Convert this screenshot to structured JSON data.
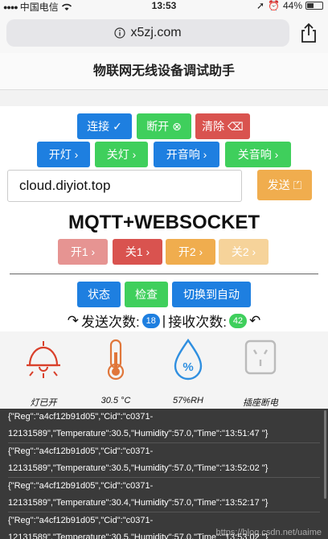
{
  "status": {
    "carrier": "中国电信",
    "time": "13:53",
    "battery": "44%",
    "battery_level": 0.44
  },
  "browser": {
    "url": "x5zj.com"
  },
  "page": {
    "title": "物联网无线设备调试助手"
  },
  "buttons": {
    "connect": "连接 ✓",
    "disconnect": "断开 ⊗",
    "clear": "清除 ⌫",
    "light_on": "开灯 ›",
    "light_off": "关灯 ›",
    "sound_on": "开音响 ›",
    "sound_off": "关音响 ›",
    "on1": "开1 ›",
    "off1": "关1 ›",
    "on2": "开2 ›",
    "off2": "关2 ›",
    "status": "状态",
    "check": "检查",
    "auto": "切换到自动"
  },
  "host": {
    "value": "cloud.diyiot.top"
  },
  "send_label": "发送 ⏍",
  "mqtt_title": "MQTT+WEBSOCKET",
  "counter": {
    "send_label": "发送次数:",
    "send_count": "18",
    "separator": "|",
    "recv_label": "接收次数:",
    "recv_count": "42"
  },
  "devices": [
    {
      "label": "灯已开"
    },
    {
      "label": "30.5 °C"
    },
    {
      "label": "57%RH"
    },
    {
      "label": "插座断电"
    }
  ],
  "log": [
    {
      "line1": "{\"Reg\":\"a4cf12b91d05\",\"Cid\":\"c0371-",
      "line2": "12131589\",\"Temperature\":30.5,\"Humidity\":57.0,\"Time\":\"13:51:47 \"}"
    },
    {
      "line1": "{\"Reg\":\"a4cf12b91d05\",\"Cid\":\"c0371-",
      "line2": "12131589\",\"Temperature\":30.5,\"Humidity\":57.0,\"Time\":\"13:52:02 \"}"
    },
    {
      "line1": "{\"Reg\":\"a4cf12b91d05\",\"Cid\":\"c0371-",
      "line2": "12131589\",\"Temperature\":30.4,\"Humidity\":57.0,\"Time\":\"13:52:17 \"}"
    },
    {
      "line1": "{\"Reg\":\"a4cf12b91d05\",\"Cid\":\"c0371-",
      "line2": "12131589\",\"Temperature\":30.5,\"Humidity\":57.0,\"Time\":\"13:53:02 \"}"
    }
  ],
  "watermark": "https://blog.csdn.net/uaime"
}
